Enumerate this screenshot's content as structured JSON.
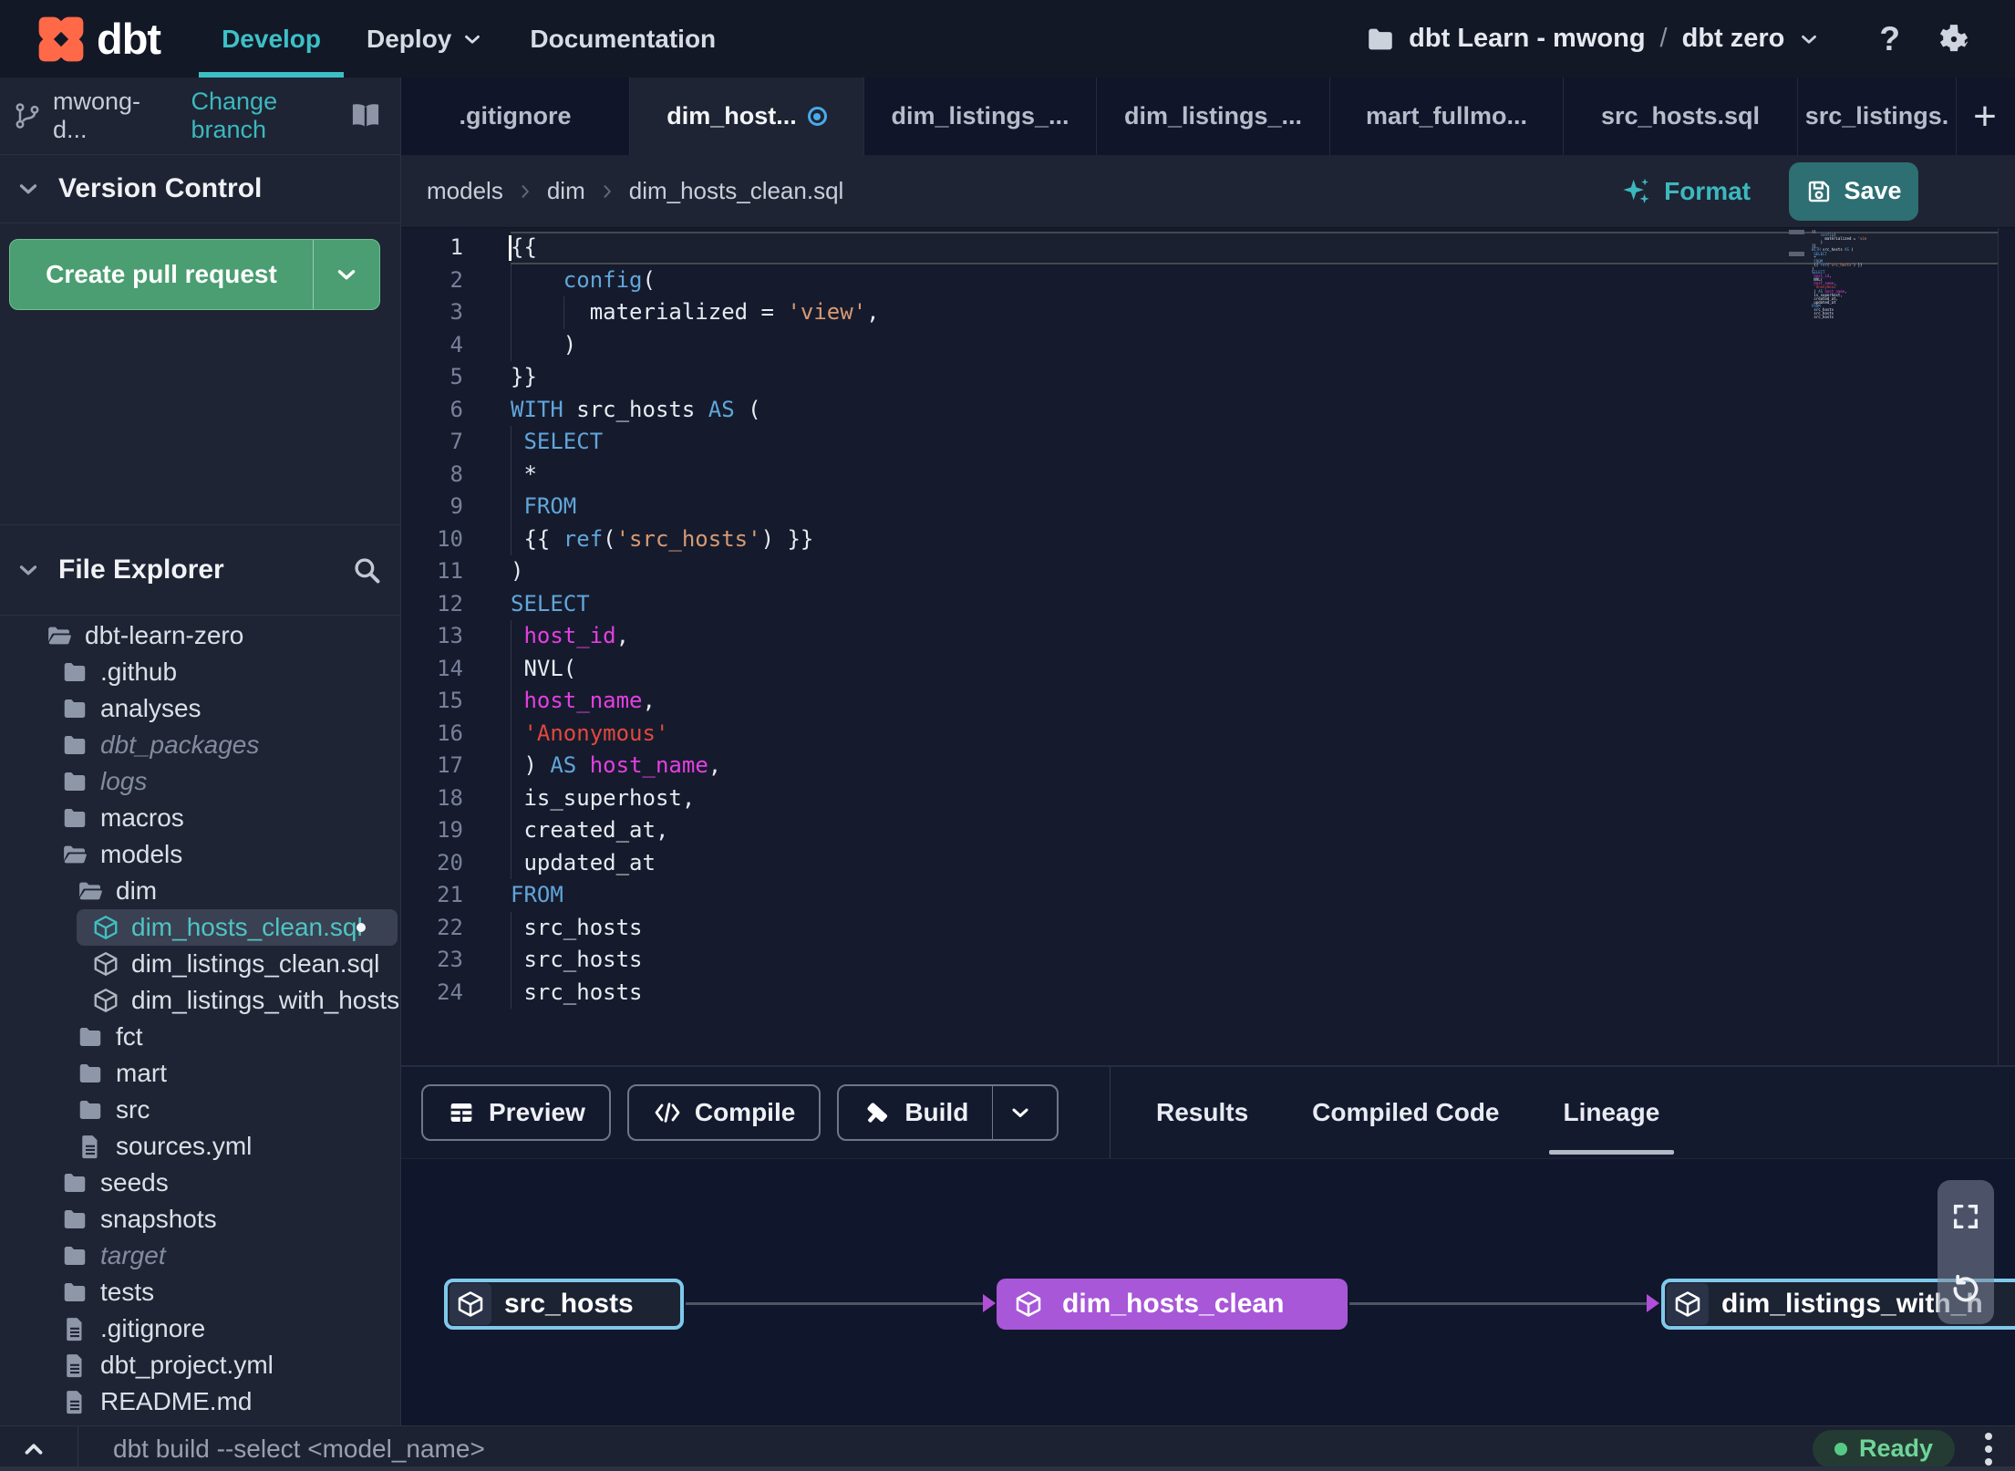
{
  "navbar": {
    "logo_text": "dbt",
    "menu": [
      {
        "label": "Develop",
        "active": true
      },
      {
        "label": "Deploy",
        "chevron": true
      },
      {
        "label": "Documentation"
      }
    ],
    "account": "dbt Learn - mwong",
    "separator": "/",
    "project": "dbt zero",
    "help_label": "?"
  },
  "sidebar": {
    "branch": {
      "name": "mwong-d...",
      "change_label": "Change branch"
    },
    "version_control": {
      "title": "Version Control",
      "create_pr_label": "Create pull request"
    },
    "file_explorer": {
      "title": "File Explorer"
    },
    "tree": [
      {
        "label": "dbt-learn-zero",
        "type": "folder-open",
        "level": 0
      },
      {
        "label": ".github",
        "type": "folder",
        "level": 1
      },
      {
        "label": "analyses",
        "type": "folder",
        "level": 1
      },
      {
        "label": "dbt_packages",
        "type": "folder",
        "level": 1,
        "muted": true
      },
      {
        "label": "logs",
        "type": "folder",
        "level": 1,
        "muted": true
      },
      {
        "label": "macros",
        "type": "folder",
        "level": 1
      },
      {
        "label": "models",
        "type": "folder-open",
        "level": 1
      },
      {
        "label": "dim",
        "type": "folder-open",
        "level": 2
      },
      {
        "label": "dim_hosts_clean.sql",
        "type": "model",
        "level": 3,
        "selected": true,
        "modified": true
      },
      {
        "label": "dim_listings_clean.sql",
        "type": "model",
        "level": 3
      },
      {
        "label": "dim_listings_with_hosts...",
        "type": "model",
        "level": 3
      },
      {
        "label": "fct",
        "type": "folder",
        "level": 2
      },
      {
        "label": "mart",
        "type": "folder",
        "level": 2
      },
      {
        "label": "src",
        "type": "folder",
        "level": 2
      },
      {
        "label": "sources.yml",
        "type": "file",
        "level": 2
      },
      {
        "label": "seeds",
        "type": "folder",
        "level": 1
      },
      {
        "label": "snapshots",
        "type": "folder",
        "level": 1
      },
      {
        "label": "target",
        "type": "folder",
        "level": 1,
        "muted": true
      },
      {
        "label": "tests",
        "type": "folder",
        "level": 1
      },
      {
        "label": ".gitignore",
        "type": "file",
        "level": 1
      },
      {
        "label": "dbt_project.yml",
        "type": "file",
        "level": 1
      },
      {
        "label": "README.md",
        "type": "file",
        "level": 1
      }
    ]
  },
  "tabs": {
    "items": [
      {
        "label": ".gitignore"
      },
      {
        "label": "dim_host...",
        "active": true,
        "unsaved": true
      },
      {
        "label": "dim_listings_..."
      },
      {
        "label": "dim_listings_..."
      },
      {
        "label": "mart_fullmo..."
      },
      {
        "label": "src_hosts.sql"
      },
      {
        "label": "src_listings."
      }
    ],
    "new_tab_label": "+"
  },
  "editor": {
    "breadcrumb": [
      "models",
      "dim",
      "dim_hosts_clean.sql"
    ],
    "format_label": "Format",
    "save_label": "Save",
    "code": [
      {
        "n": 1,
        "current": true,
        "tokens": [
          [
            "{{",
            "pl"
          ]
        ]
      },
      {
        "n": 2,
        "g": [
          0
        ],
        "tokens": [
          [
            "    ",
            "pl"
          ],
          [
            "config",
            "kw"
          ],
          [
            "(",
            "pl"
          ]
        ]
      },
      {
        "n": 3,
        "g": [
          0,
          4
        ],
        "tokens": [
          [
            "      ",
            "pl"
          ],
          [
            "materialized = ",
            "pl"
          ],
          [
            "'view'",
            "str"
          ],
          [
            ",",
            "pl"
          ]
        ]
      },
      {
        "n": 4,
        "g": [
          0
        ],
        "tokens": [
          [
            "    )",
            "pl"
          ]
        ]
      },
      {
        "n": 5,
        "tokens": [
          [
            "}}",
            "pl"
          ]
        ]
      },
      {
        "n": 6,
        "tokens": [
          [
            "WITH",
            "kw"
          ],
          [
            " src_hosts ",
            "pl"
          ],
          [
            "AS",
            "kw"
          ],
          [
            " (",
            "pl"
          ]
        ]
      },
      {
        "n": 7,
        "g": [
          0
        ],
        "tokens": [
          [
            " ",
            "pl"
          ],
          [
            "SELECT",
            "kw"
          ]
        ]
      },
      {
        "n": 8,
        "g": [
          0
        ],
        "tokens": [
          [
            " *",
            "pl"
          ]
        ]
      },
      {
        "n": 9,
        "g": [
          0
        ],
        "tokens": [
          [
            " ",
            "pl"
          ],
          [
            "FROM",
            "kw"
          ]
        ]
      },
      {
        "n": 10,
        "g": [
          0
        ],
        "tokens": [
          [
            " {{ ",
            "pl"
          ],
          [
            "ref",
            "kw"
          ],
          [
            "(",
            "pl"
          ],
          [
            "'src_hosts'",
            "str"
          ],
          [
            ") }}",
            "pl"
          ]
        ]
      },
      {
        "n": 11,
        "tokens": [
          [
            ")",
            "pl"
          ]
        ]
      },
      {
        "n": 12,
        "tokens": [
          [
            "SELECT",
            "kw"
          ]
        ]
      },
      {
        "n": 13,
        "g": [
          0
        ],
        "tokens": [
          [
            " ",
            "pl"
          ],
          [
            "host_id",
            "mag"
          ],
          [
            ",",
            "pl"
          ]
        ]
      },
      {
        "n": 14,
        "g": [
          0
        ],
        "tokens": [
          [
            " NVL(",
            "pl"
          ]
        ]
      },
      {
        "n": 15,
        "g": [
          0
        ],
        "tokens": [
          [
            " ",
            "pl"
          ],
          [
            "host_name",
            "mag"
          ],
          [
            ",",
            "pl"
          ]
        ]
      },
      {
        "n": 16,
        "g": [
          0
        ],
        "tokens": [
          [
            " ",
            "pl"
          ],
          [
            "'Anonymous'",
            "red"
          ]
        ]
      },
      {
        "n": 17,
        "g": [
          0
        ],
        "tokens": [
          [
            " ) ",
            "pl"
          ],
          [
            "AS",
            "kw"
          ],
          [
            " ",
            "pl"
          ],
          [
            "host_name",
            "mag"
          ],
          [
            ",",
            "pl"
          ]
        ]
      },
      {
        "n": 18,
        "g": [
          0
        ],
        "tokens": [
          [
            " is_superhost,",
            "pl"
          ]
        ]
      },
      {
        "n": 19,
        "g": [
          0
        ],
        "tokens": [
          [
            " created_at,",
            "pl"
          ]
        ]
      },
      {
        "n": 20,
        "g": [
          0
        ],
        "tokens": [
          [
            " updated_at",
            "pl"
          ]
        ]
      },
      {
        "n": 21,
        "tokens": [
          [
            "FROM",
            "kw"
          ]
        ]
      },
      {
        "n": 22,
        "g": [
          0
        ],
        "tokens": [
          [
            " src_hosts",
            "pl"
          ]
        ]
      },
      {
        "n": 23,
        "g": [
          0
        ],
        "tokens": [
          [
            " src_hosts",
            "pl"
          ]
        ]
      },
      {
        "n": 24,
        "g": [
          0
        ],
        "tokens": [
          [
            " src_hosts",
            "pl"
          ]
        ]
      }
    ]
  },
  "bottom_panel": {
    "actions": [
      {
        "label": "Preview",
        "icon": "table"
      },
      {
        "label": "Compile",
        "icon": "code"
      },
      {
        "label": "Build",
        "icon": "hammer",
        "split": true
      }
    ],
    "tabs": [
      {
        "label": "Results"
      },
      {
        "label": "Compiled Code"
      },
      {
        "label": "Lineage",
        "active": true
      }
    ],
    "lineage": {
      "nodes": [
        {
          "label": "src_hosts",
          "kind": "source"
        },
        {
          "label": "dim_hosts_clean",
          "kind": "model"
        },
        {
          "label": "dim_listings_with_h",
          "kind": "source"
        }
      ]
    }
  },
  "command_bar": {
    "placeholder": "dbt build --select <model_name>",
    "status": "Ready"
  },
  "colors": {
    "accent_teal": "#3cb8bf",
    "pr_green": "#4a9e71",
    "save_teal": "#2d6f73",
    "ready_green": "#57c987",
    "node_purple": "#a757d8",
    "node_blue": "#7fc9eb",
    "logo_orange": "#ff6947",
    "keyword_blue": "#61a6da",
    "string_orange": "#d79a74",
    "identifier_magenta": "#e43fe0",
    "string_red": "#e2483d",
    "unsaved_blue": "#4aa9e9"
  }
}
